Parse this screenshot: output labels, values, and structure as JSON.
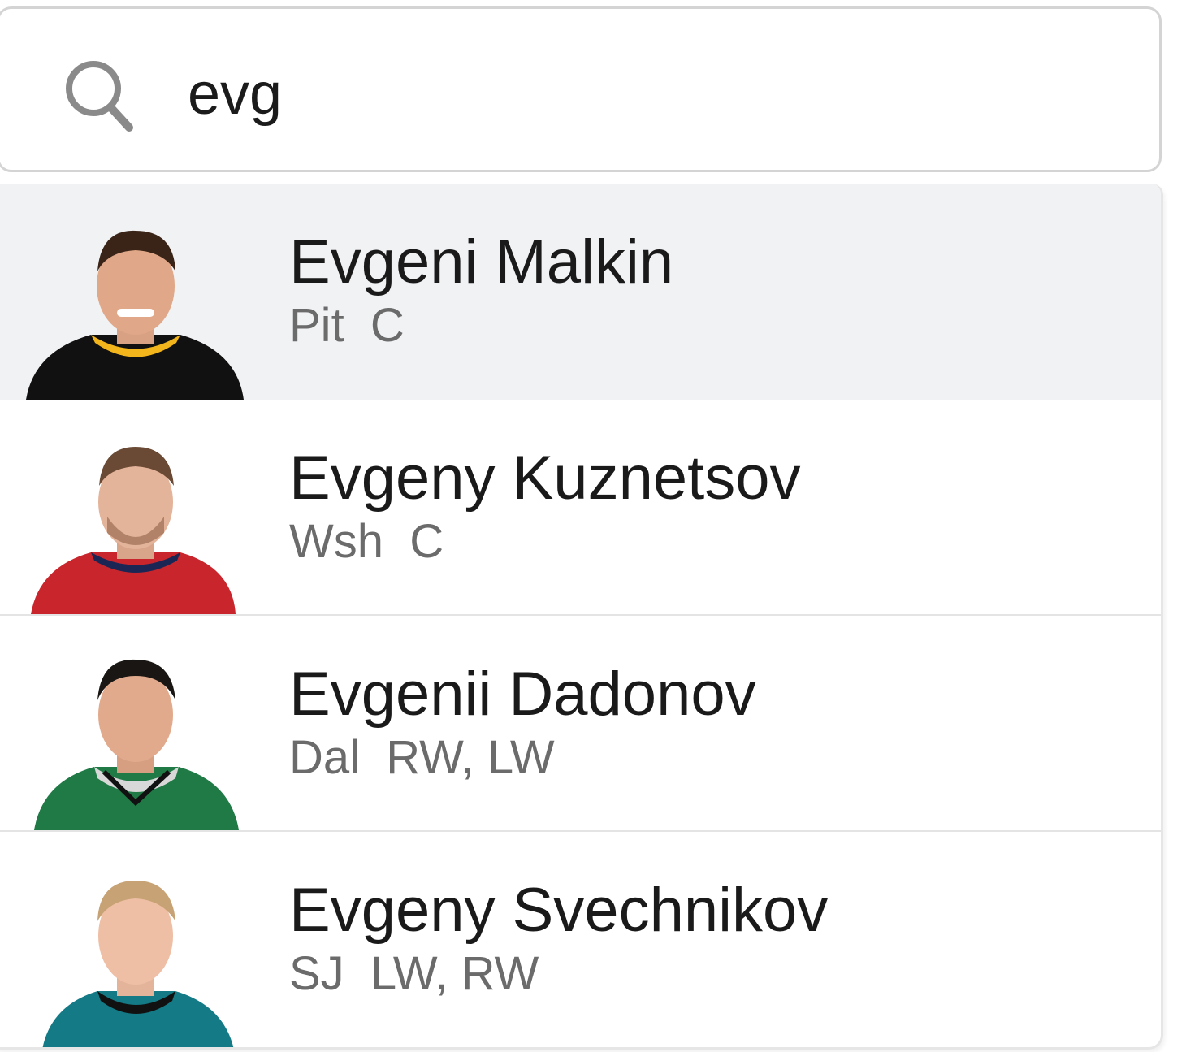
{
  "search": {
    "value": "evg",
    "icon": "search-icon"
  },
  "results": [
    {
      "name": "Evgeni Malkin",
      "team": "Pit",
      "position": "C",
      "meta": "Pit  C",
      "highlighted": true,
      "jersey_color": "#111111",
      "trim_color": "#f2b51c"
    },
    {
      "name": "Evgeny Kuznetsov",
      "team": "Wsh",
      "position": "C",
      "meta": "Wsh  C",
      "highlighted": false,
      "jersey_color": "#c8262c",
      "trim_color": "#1c2654"
    },
    {
      "name": "Evgenii Dadonov",
      "team": "Dal",
      "position": "RW, LW",
      "meta": "Dal  RW, LW",
      "highlighted": false,
      "jersey_color": "#1f7a45",
      "trim_color": "#d8d8d8"
    },
    {
      "name": "Evgeny Svechnikov",
      "team": "SJ",
      "position": "LW, RW",
      "meta": "SJ  LW, RW",
      "highlighted": false,
      "jersey_color": "#137a86",
      "trim_color": "#111111"
    }
  ],
  "colors": {
    "highlight_bg": "#f1f2f4",
    "border": "#d4d4d4",
    "meta_text": "#6b6b6b"
  }
}
